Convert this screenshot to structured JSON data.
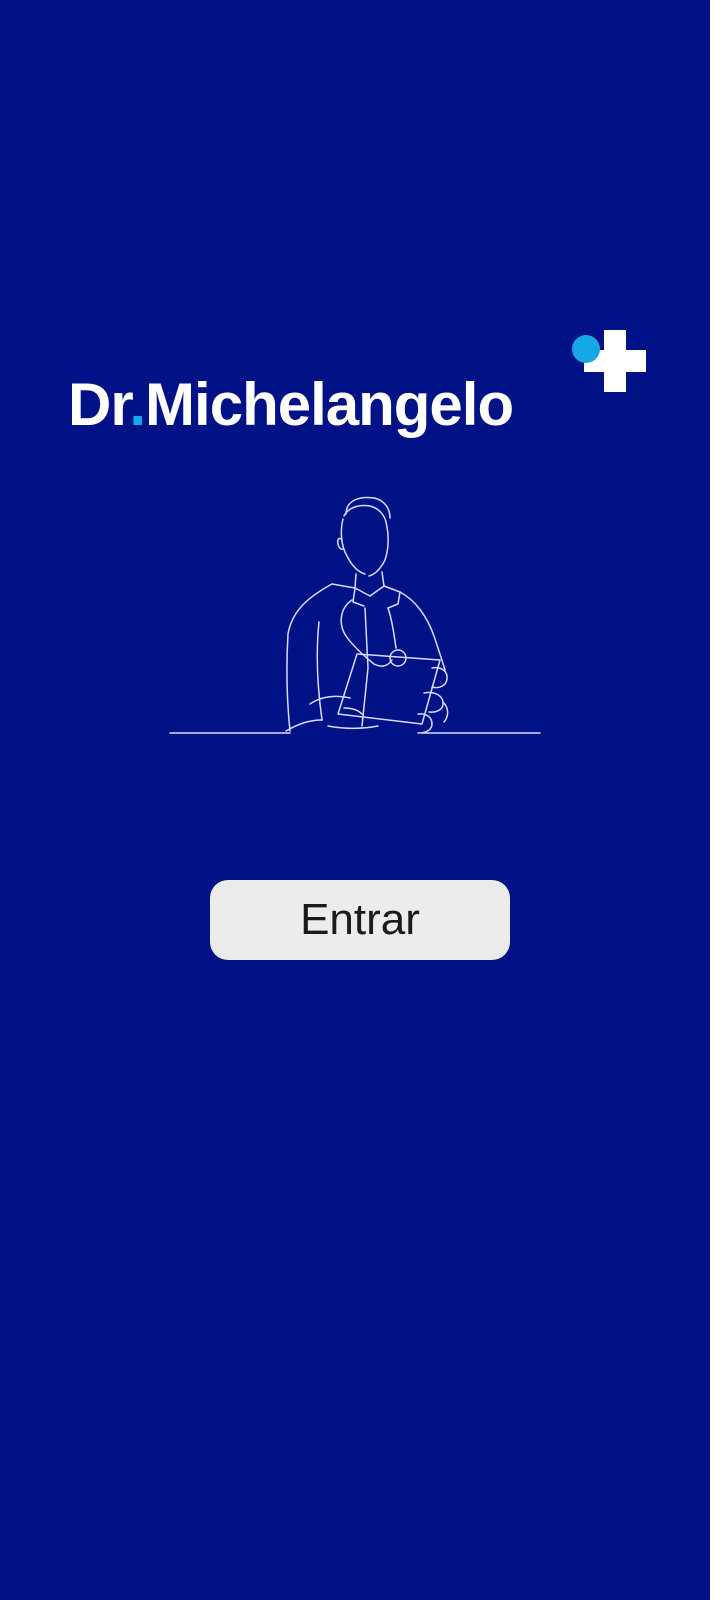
{
  "app": {
    "brand_prefix": "Dr",
    "brand_dot": ".",
    "brand_name": "Michelangelo"
  },
  "illustration": {
    "icon": "doctor-line-art-icon"
  },
  "actions": {
    "enter_label": "Entrar"
  },
  "colors": {
    "background": "#001286",
    "logo_text": "#ffffff",
    "accent": "#17a7e6",
    "button_background": "#ececec",
    "button_text": "#1b1b1b"
  }
}
